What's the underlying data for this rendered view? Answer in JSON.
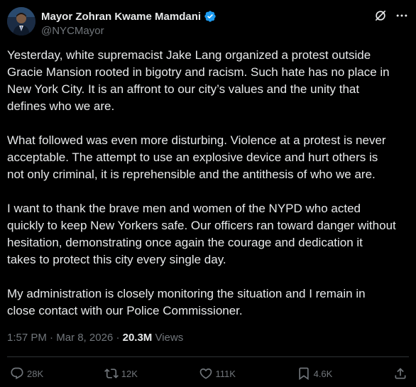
{
  "author": {
    "display_name": "Mayor Zohran Kwame Mamdani",
    "handle": "@NYCMayor"
  },
  "post": {
    "paragraphs": [
      "Yesterday, white supremacist Jake Lang organized a protest outside\nGracie Mansion rooted in bigotry and racism. Such hate has no place in\nNew York City. It is an affront to our city’s values and the unity that\ndefines who we are.",
      "What followed was even more disturbing. Violence at a protest is never\nacceptable. The attempt to use an explosive device and hurt others is\nnot only criminal, it is reprehensible and the antithesis of who we are.",
      "I want to thank the brave men and women of the NYPD who acted\nquickly to keep New Yorkers safe. Our officers ran toward danger without\nhesitation, demonstrating once again the courage and dedication it\ntakes to protect this city every single day.",
      "My administration is closely monitoring the situation and I remain in\nclose contact with our Police Commissioner."
    ],
    "time": "1:57 PM",
    "separator": "·",
    "date": "Mar 8, 2026",
    "views_count": "20.3M",
    "views_label": "Views"
  },
  "actions": {
    "replies": "28K",
    "reposts": "12K",
    "likes": "111K",
    "bookmarks": "4.6K"
  },
  "colors": {
    "background": "#000000",
    "text": "#e7e9ea",
    "muted": "#71767b",
    "verified": "#1d9bf0"
  },
  "icons": {
    "verified": "verified-badge-icon",
    "grok": "grok-icon",
    "more": "more-options-icon",
    "reply": "reply-icon",
    "repost": "repost-icon",
    "like": "like-icon",
    "bookmark": "bookmark-icon",
    "share": "share-icon"
  }
}
